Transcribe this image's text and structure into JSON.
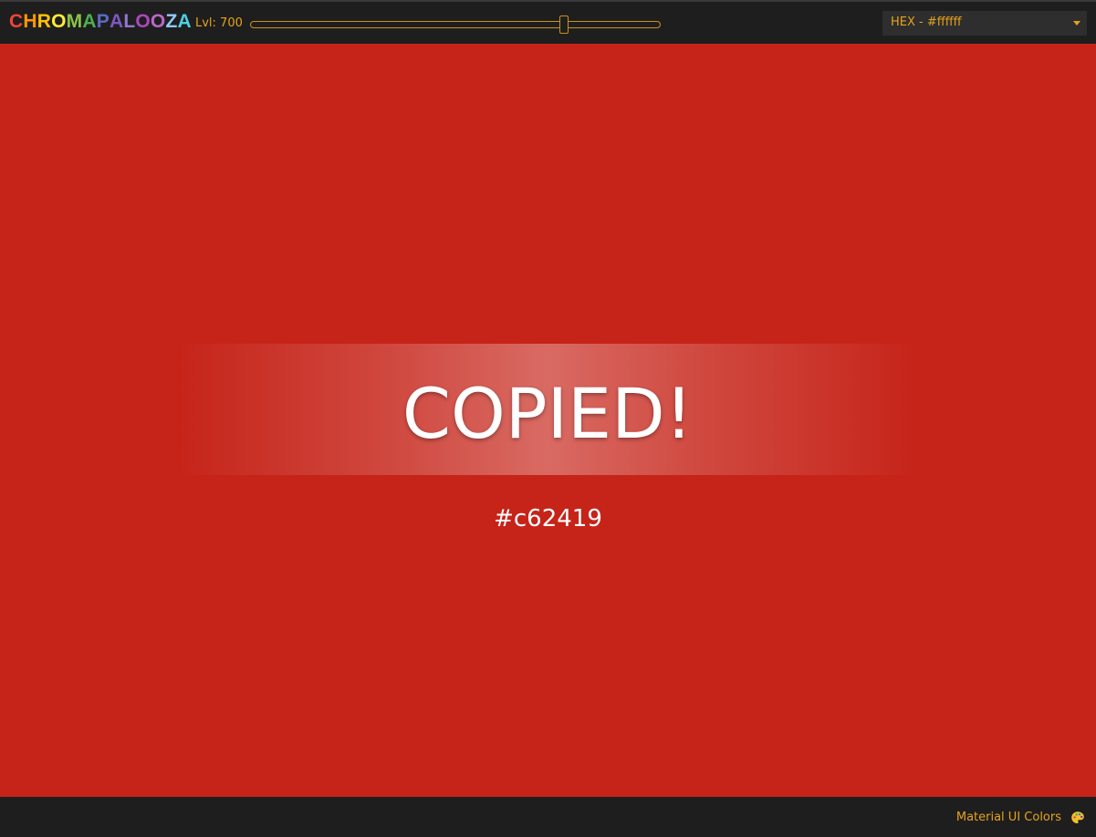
{
  "header": {
    "logo_letters": [
      "C",
      "H",
      "R",
      "O",
      "M",
      "A",
      "P",
      "A",
      "L",
      "O",
      "O",
      "Z",
      "A"
    ],
    "logo_colors": [
      "#f44336",
      "#ff9800",
      "#ffc107",
      "#ffeb3b",
      "#8bc34a",
      "#4caf50",
      "#5c6bc0",
      "#7e57c2",
      "#9575cd",
      "#ab47bc",
      "#ba68c8",
      "#90caf9",
      "#4dd0e1"
    ],
    "level_label": "Lvl: 700",
    "level_slider": {
      "min": 50,
      "max": 900,
      "value": 700
    },
    "format_select": {
      "value": "HEX - #ffffff"
    }
  },
  "main": {
    "background_color": "#c62419",
    "copied_text": "COPIED!",
    "hex_value": "#c62419"
  },
  "footer": {
    "link_label": "Material UI Colors",
    "icon": "palette-icon"
  },
  "colors": {
    "accent": "#e6a21c",
    "bar_background": "#1e1e1e"
  }
}
